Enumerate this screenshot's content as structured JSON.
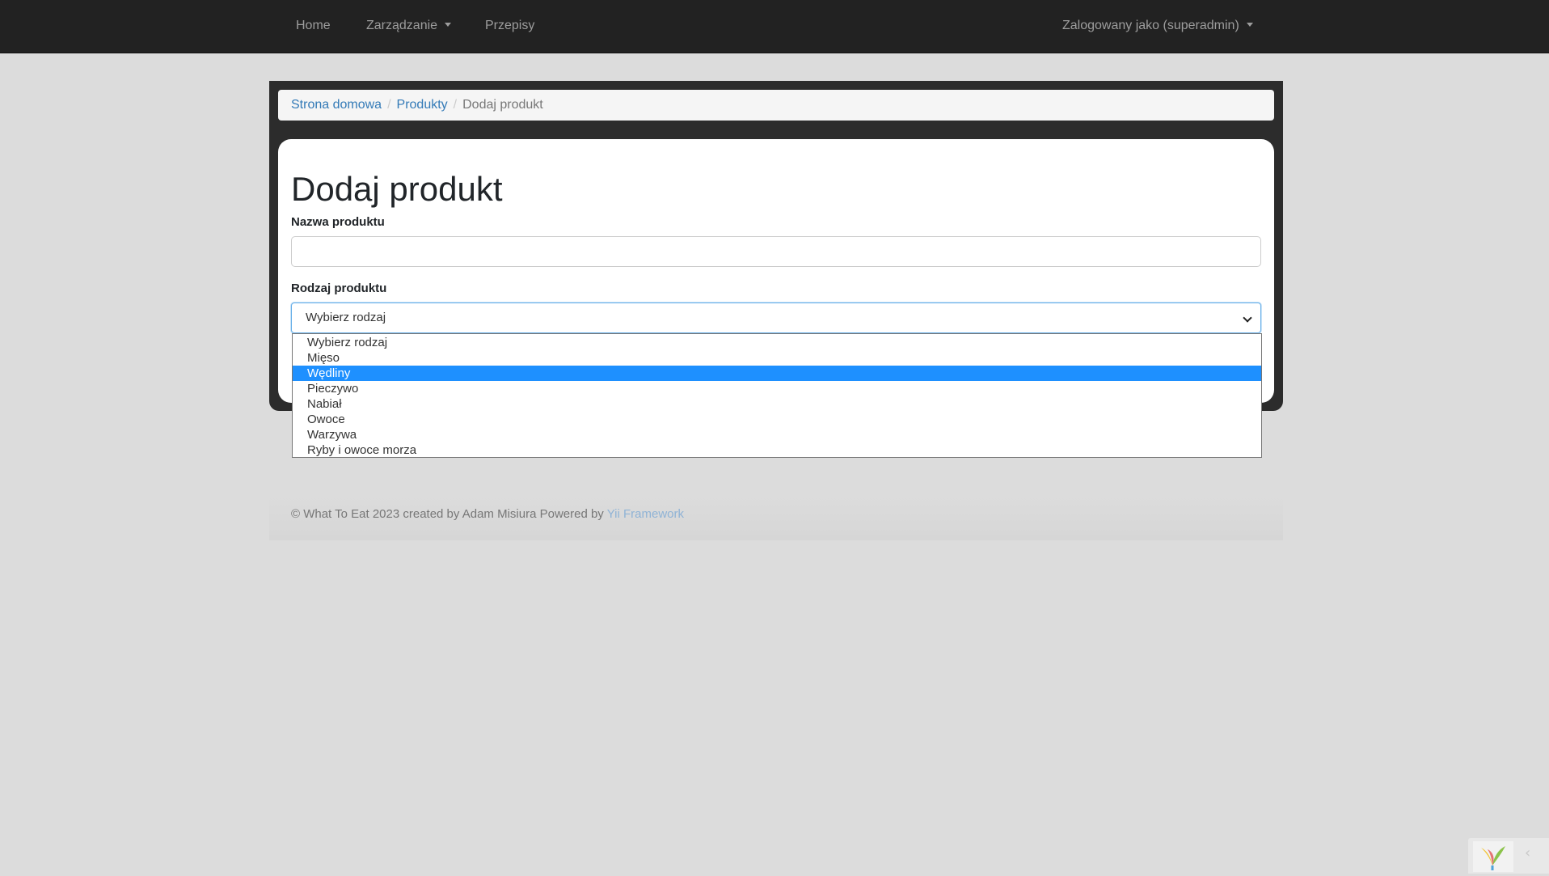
{
  "navbar": {
    "items": [
      {
        "label": "Home"
      },
      {
        "label": "Zarządzanie"
      },
      {
        "label": "Przepisy"
      }
    ],
    "user_label": "Zalogowany jako (superadmin)"
  },
  "breadcrumb": {
    "items": [
      "Strona domowa",
      "Produkty"
    ],
    "separator": "/",
    "active": "Dodaj produkt"
  },
  "form": {
    "title": "Dodaj produkt",
    "name_label": "Nazwa produktu",
    "name_value": "",
    "type_label": "Rodzaj produktu",
    "type_selected": "Wybierz rodzaj",
    "options": [
      "Wybierz rodzaj",
      "Mięso",
      "Wędliny",
      "Pieczywo",
      "Nabiał",
      "Owoce",
      "Warzywa",
      "Ryby i owoce morza"
    ],
    "highlighted_option": "Wędliny"
  },
  "footer": {
    "text": "© What To Eat 2023 created by Adam Misiura Powered by ",
    "link": "Yii Framework"
  },
  "debug_toolbar": {
    "logo_icon": "yii-logo-icon",
    "toggle_icon": "chevron-left-icon",
    "toggle_glyph": "‹"
  },
  "colors": {
    "navbar_bg": "#222222",
    "link": "#337ab7",
    "highlight": "#1e90ff",
    "page_bg": "#dcdcdc"
  }
}
